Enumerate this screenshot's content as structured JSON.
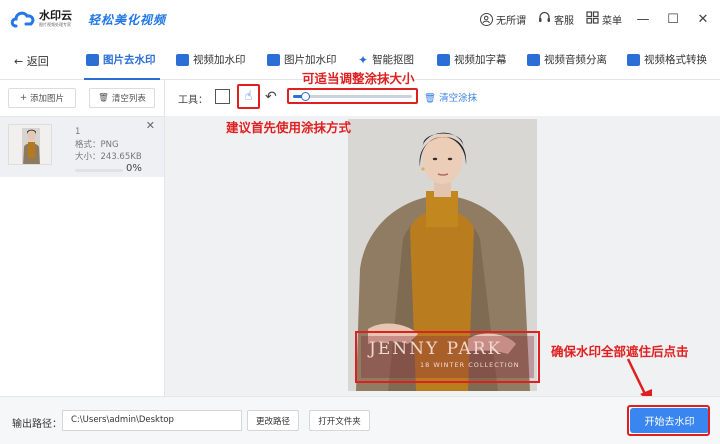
{
  "app": {
    "name": "水印云",
    "subtitle": "图片视频处理专家",
    "slogan": "轻松美化视频"
  },
  "titlebar": {
    "items": [
      {
        "label": "无所谓",
        "icon": "user-icon"
      },
      {
        "label": "客服",
        "icon": "headset-icon"
      },
      {
        "label": "菜单",
        "icon": "menu-icon"
      }
    ],
    "window_controls": [
      "minimize-icon",
      "maximize-icon",
      "close-icon"
    ]
  },
  "nav": {
    "back_label": "返回",
    "tabs": [
      {
        "label": "图片去水印",
        "active": true
      },
      {
        "label": "视频加水印"
      },
      {
        "label": "图片加水印"
      },
      {
        "label": "智能抠图"
      },
      {
        "label": "视频加字幕"
      },
      {
        "label": "视频音频分离"
      },
      {
        "label": "视频格式转换"
      }
    ]
  },
  "left_panel": {
    "add_button": "添加图片",
    "clear_button": "清空列表",
    "file": {
      "name": "1",
      "format": "格式：PNG",
      "size": "大小：243.65KB",
      "progress_label": "0%",
      "progress": 0
    }
  },
  "toolbar": {
    "label": "工具：",
    "clear_brush": "清空涂抹",
    "brush_size_fraction": 0.1
  },
  "annotations": {
    "slider_hint": "可适当调整涂抹大小",
    "tool_hint": "建议首先使用涂抹方式",
    "watermark_hint": "确保水印全部遮住后点击"
  },
  "watermark": {
    "title": "JENNY PARK",
    "subtitle": "18 WINTER COLLECTION"
  },
  "bottom": {
    "output_label": "输出路径：",
    "output_path": "C:\\Users\\admin\\Desktop",
    "change_path": "更改路径",
    "open_folder": "打开文件夹",
    "start_button": "开始去水印"
  },
  "colors": {
    "accent": "#2b6fd6",
    "highlight": "#e02020",
    "start_button": "#3a86f0"
  }
}
